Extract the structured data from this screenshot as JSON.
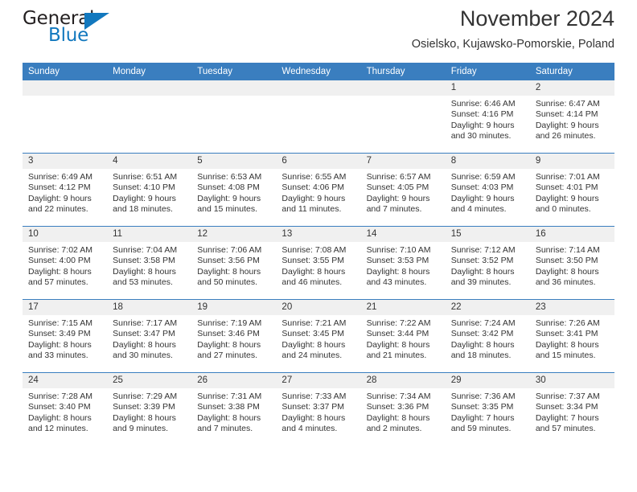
{
  "brand": {
    "name_primary": "General",
    "name_secondary": "Blue",
    "accent_color": "#1278be"
  },
  "header": {
    "title": "November 2024",
    "subtitle": "Osielsko, Kujawsko-Pomorskie, Poland"
  },
  "theme": {
    "header_blue": "#3a7ebf",
    "daynum_gray": "#f0f0f0",
    "text": "#333333"
  },
  "weekday_headers": [
    "Sunday",
    "Monday",
    "Tuesday",
    "Wednesday",
    "Thursday",
    "Friday",
    "Saturday"
  ],
  "labels": {
    "sunrise_prefix": "Sunrise: ",
    "sunset_prefix": "Sunset: ",
    "daylight_prefix": "Daylight: "
  },
  "weeks": [
    [
      {
        "day": "",
        "empty": true
      },
      {
        "day": "",
        "empty": true
      },
      {
        "day": "",
        "empty": true
      },
      {
        "day": "",
        "empty": true
      },
      {
        "day": "",
        "empty": true
      },
      {
        "day": "1",
        "sunrise": "Sunrise: 6:46 AM",
        "sunset": "Sunset: 4:16 PM",
        "daylight_line1": "Daylight: 9 hours",
        "daylight_line2": "and 30 minutes."
      },
      {
        "day": "2",
        "sunrise": "Sunrise: 6:47 AM",
        "sunset": "Sunset: 4:14 PM",
        "daylight_line1": "Daylight: 9 hours",
        "daylight_line2": "and 26 minutes."
      }
    ],
    [
      {
        "day": "3",
        "sunrise": "Sunrise: 6:49 AM",
        "sunset": "Sunset: 4:12 PM",
        "daylight_line1": "Daylight: 9 hours",
        "daylight_line2": "and 22 minutes."
      },
      {
        "day": "4",
        "sunrise": "Sunrise: 6:51 AM",
        "sunset": "Sunset: 4:10 PM",
        "daylight_line1": "Daylight: 9 hours",
        "daylight_line2": "and 18 minutes."
      },
      {
        "day": "5",
        "sunrise": "Sunrise: 6:53 AM",
        "sunset": "Sunset: 4:08 PM",
        "daylight_line1": "Daylight: 9 hours",
        "daylight_line2": "and 15 minutes."
      },
      {
        "day": "6",
        "sunrise": "Sunrise: 6:55 AM",
        "sunset": "Sunset: 4:06 PM",
        "daylight_line1": "Daylight: 9 hours",
        "daylight_line2": "and 11 minutes."
      },
      {
        "day": "7",
        "sunrise": "Sunrise: 6:57 AM",
        "sunset": "Sunset: 4:05 PM",
        "daylight_line1": "Daylight: 9 hours",
        "daylight_line2": "and 7 minutes."
      },
      {
        "day": "8",
        "sunrise": "Sunrise: 6:59 AM",
        "sunset": "Sunset: 4:03 PM",
        "daylight_line1": "Daylight: 9 hours",
        "daylight_line2": "and 4 minutes."
      },
      {
        "day": "9",
        "sunrise": "Sunrise: 7:01 AM",
        "sunset": "Sunset: 4:01 PM",
        "daylight_line1": "Daylight: 9 hours",
        "daylight_line2": "and 0 minutes."
      }
    ],
    [
      {
        "day": "10",
        "sunrise": "Sunrise: 7:02 AM",
        "sunset": "Sunset: 4:00 PM",
        "daylight_line1": "Daylight: 8 hours",
        "daylight_line2": "and 57 minutes."
      },
      {
        "day": "11",
        "sunrise": "Sunrise: 7:04 AM",
        "sunset": "Sunset: 3:58 PM",
        "daylight_line1": "Daylight: 8 hours",
        "daylight_line2": "and 53 minutes."
      },
      {
        "day": "12",
        "sunrise": "Sunrise: 7:06 AM",
        "sunset": "Sunset: 3:56 PM",
        "daylight_line1": "Daylight: 8 hours",
        "daylight_line2": "and 50 minutes."
      },
      {
        "day": "13",
        "sunrise": "Sunrise: 7:08 AM",
        "sunset": "Sunset: 3:55 PM",
        "daylight_line1": "Daylight: 8 hours",
        "daylight_line2": "and 46 minutes."
      },
      {
        "day": "14",
        "sunrise": "Sunrise: 7:10 AM",
        "sunset": "Sunset: 3:53 PM",
        "daylight_line1": "Daylight: 8 hours",
        "daylight_line2": "and 43 minutes."
      },
      {
        "day": "15",
        "sunrise": "Sunrise: 7:12 AM",
        "sunset": "Sunset: 3:52 PM",
        "daylight_line1": "Daylight: 8 hours",
        "daylight_line2": "and 39 minutes."
      },
      {
        "day": "16",
        "sunrise": "Sunrise: 7:14 AM",
        "sunset": "Sunset: 3:50 PM",
        "daylight_line1": "Daylight: 8 hours",
        "daylight_line2": "and 36 minutes."
      }
    ],
    [
      {
        "day": "17",
        "sunrise": "Sunrise: 7:15 AM",
        "sunset": "Sunset: 3:49 PM",
        "daylight_line1": "Daylight: 8 hours",
        "daylight_line2": "and 33 minutes."
      },
      {
        "day": "18",
        "sunrise": "Sunrise: 7:17 AM",
        "sunset": "Sunset: 3:47 PM",
        "daylight_line1": "Daylight: 8 hours",
        "daylight_line2": "and 30 minutes."
      },
      {
        "day": "19",
        "sunrise": "Sunrise: 7:19 AM",
        "sunset": "Sunset: 3:46 PM",
        "daylight_line1": "Daylight: 8 hours",
        "daylight_line2": "and 27 minutes."
      },
      {
        "day": "20",
        "sunrise": "Sunrise: 7:21 AM",
        "sunset": "Sunset: 3:45 PM",
        "daylight_line1": "Daylight: 8 hours",
        "daylight_line2": "and 24 minutes."
      },
      {
        "day": "21",
        "sunrise": "Sunrise: 7:22 AM",
        "sunset": "Sunset: 3:44 PM",
        "daylight_line1": "Daylight: 8 hours",
        "daylight_line2": "and 21 minutes."
      },
      {
        "day": "22",
        "sunrise": "Sunrise: 7:24 AM",
        "sunset": "Sunset: 3:42 PM",
        "daylight_line1": "Daylight: 8 hours",
        "daylight_line2": "and 18 minutes."
      },
      {
        "day": "23",
        "sunrise": "Sunrise: 7:26 AM",
        "sunset": "Sunset: 3:41 PM",
        "daylight_line1": "Daylight: 8 hours",
        "daylight_line2": "and 15 minutes."
      }
    ],
    [
      {
        "day": "24",
        "sunrise": "Sunrise: 7:28 AM",
        "sunset": "Sunset: 3:40 PM",
        "daylight_line1": "Daylight: 8 hours",
        "daylight_line2": "and 12 minutes."
      },
      {
        "day": "25",
        "sunrise": "Sunrise: 7:29 AM",
        "sunset": "Sunset: 3:39 PM",
        "daylight_line1": "Daylight: 8 hours",
        "daylight_line2": "and 9 minutes."
      },
      {
        "day": "26",
        "sunrise": "Sunrise: 7:31 AM",
        "sunset": "Sunset: 3:38 PM",
        "daylight_line1": "Daylight: 8 hours",
        "daylight_line2": "and 7 minutes."
      },
      {
        "day": "27",
        "sunrise": "Sunrise: 7:33 AM",
        "sunset": "Sunset: 3:37 PM",
        "daylight_line1": "Daylight: 8 hours",
        "daylight_line2": "and 4 minutes."
      },
      {
        "day": "28",
        "sunrise": "Sunrise: 7:34 AM",
        "sunset": "Sunset: 3:36 PM",
        "daylight_line1": "Daylight: 8 hours",
        "daylight_line2": "and 2 minutes."
      },
      {
        "day": "29",
        "sunrise": "Sunrise: 7:36 AM",
        "sunset": "Sunset: 3:35 PM",
        "daylight_line1": "Daylight: 7 hours",
        "daylight_line2": "and 59 minutes."
      },
      {
        "day": "30",
        "sunrise": "Sunrise: 7:37 AM",
        "sunset": "Sunset: 3:34 PM",
        "daylight_line1": "Daylight: 7 hours",
        "daylight_line2": "and 57 minutes."
      }
    ]
  ]
}
